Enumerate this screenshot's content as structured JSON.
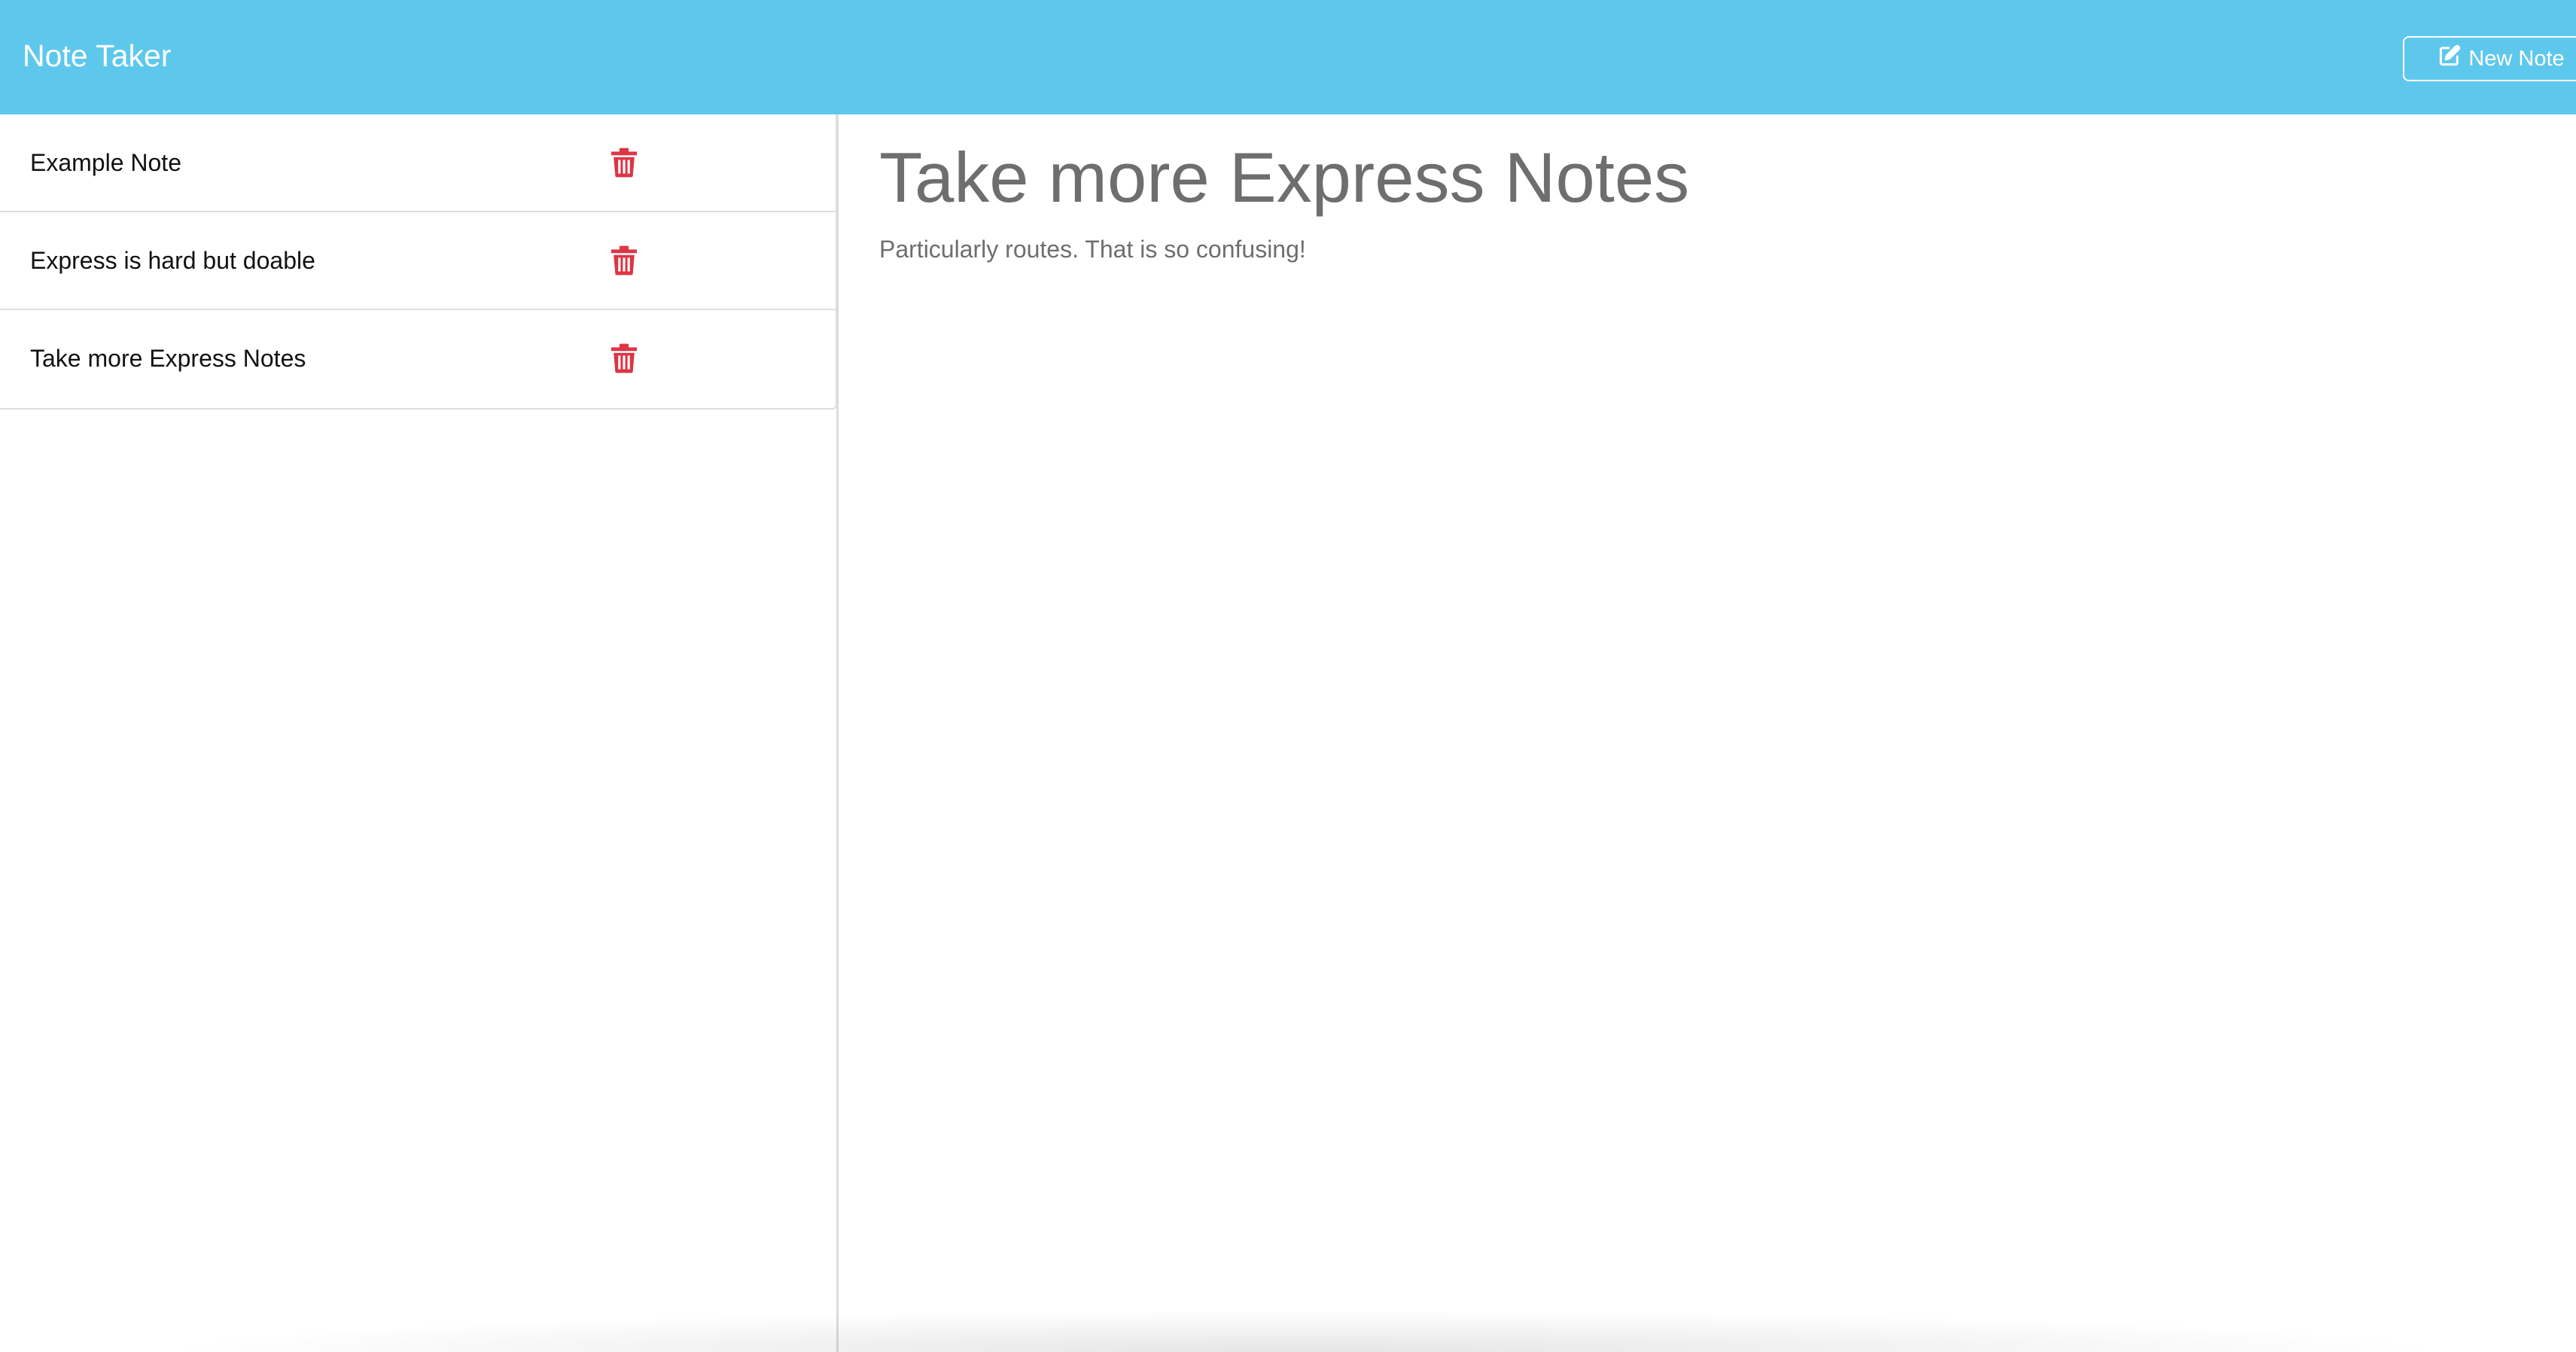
{
  "header": {
    "brand": "Note Taker",
    "new_note_label": "New Note",
    "new_note_icon": "pencil-square-icon",
    "bg_color": "#5ec8ec"
  },
  "sidebar": {
    "notes": [
      {
        "title": "Example Note",
        "icon": "trash-icon"
      },
      {
        "title": "Express is hard but doable",
        "icon": "trash-icon"
      },
      {
        "title": "Take more Express Notes",
        "icon": "trash-icon"
      }
    ],
    "delete_icon_color": "#dc3545"
  },
  "main": {
    "note_title": "Take more Express Notes",
    "note_text": "Particularly routes. That is so confusing!"
  }
}
